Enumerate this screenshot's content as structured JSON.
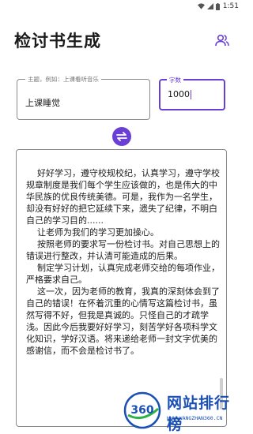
{
  "status_bar": {
    "time": "1:51"
  },
  "app": {
    "title": "检讨书生成"
  },
  "topic_field": {
    "label": "主题，例如：上课看听音乐",
    "value": "上课睡觉"
  },
  "count_field": {
    "label": "字数",
    "value": "1000"
  },
  "result": {
    "text": "    好好学习，遵守校规校纪，认真学习，遵守学校规章制度是我们每个学生应该做的，也是伟大的中华民族的优良传统美德。可是，我作为一名学生，却没有好好的把它延续下来，遗失了纪律，不明白自己的学习目的......\n    让老师为我们的学习更加操心。\n    按照老师的要求写一份检讨书。对自己思想上的错误进行整改，并认清可能造成的后果。\n    制定学习计划，认真完成老师交给的每项作业，严格要求自己。\n    这一次，因为老师的教育，我真的深刻体会到了自己的错误！在怀着沉重的心情写这篇检讨书，虽然写得不好，但我是真诚的。只怪自己的才疏学浅。因此今后我要好好学习，刻苦学好各项科学文化知识，学好汉语。将来递给老师一封文字优美的感谢信，而不会是检讨书了。"
  },
  "icons": {
    "profile": "people-icon",
    "swap": "swap-arrows-icon"
  },
  "colors": {
    "accent": "#6a3fd4"
  },
  "watermark": {
    "badge": "360",
    "text": "网站排行榜",
    "sub": "WWW.WANGZHAN360.CN"
  }
}
